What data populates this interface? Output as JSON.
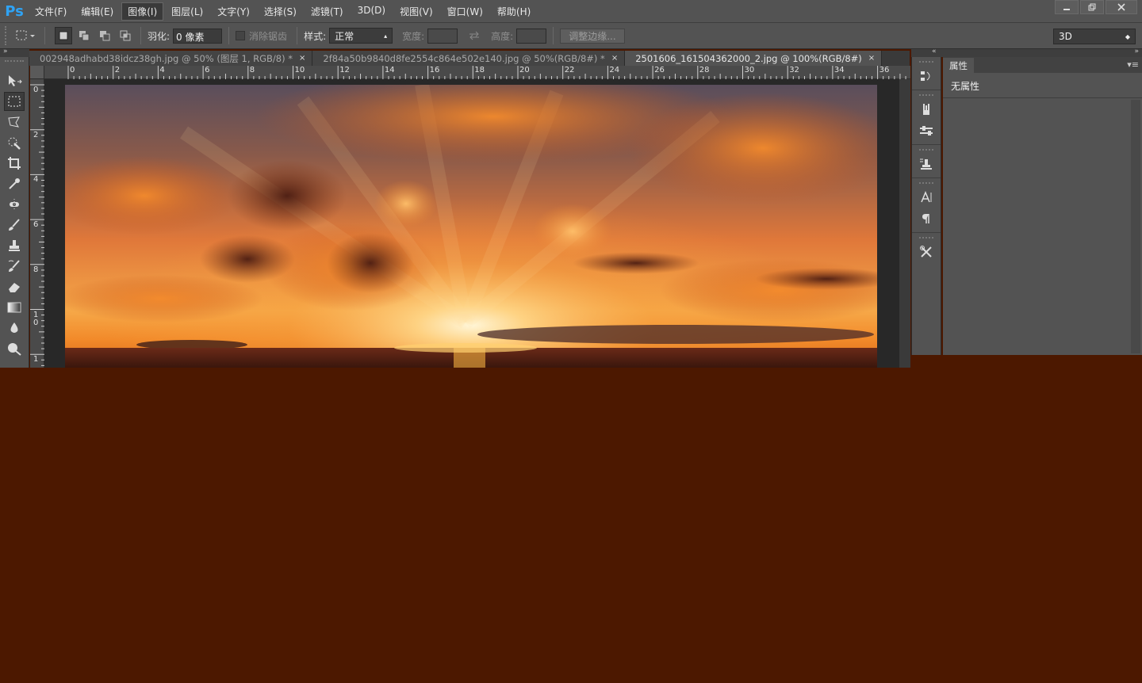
{
  "app": {
    "logo": "Ps"
  },
  "menu": [
    {
      "label": "文件(F)"
    },
    {
      "label": "编辑(E)"
    },
    {
      "label": "图像(I)",
      "active": true
    },
    {
      "label": "图层(L)"
    },
    {
      "label": "文字(Y)"
    },
    {
      "label": "选择(S)"
    },
    {
      "label": "滤镜(T)"
    },
    {
      "label": "3D(D)"
    },
    {
      "label": "视图(V)"
    },
    {
      "label": "窗口(W)"
    },
    {
      "label": "帮助(H)"
    }
  ],
  "options": {
    "feather_label": "羽化:",
    "feather_value": "0 像素",
    "antialias_label": "消除锯齿",
    "style_label": "样式:",
    "style_value": "正常",
    "width_label": "宽度:",
    "height_label": "高度:",
    "refine_edge_label": "调整边缘...",
    "workspace_value": "3D"
  },
  "tabs": [
    {
      "label": "002948adhabd38idcz38gh.jpg @ 50% (图层 1, RGB/8) *",
      "active": false
    },
    {
      "label": "2f84a50b9840d8fe2554c864e502e140.jpg @ 50%(RGB/8#) *",
      "active": false
    },
    {
      "label": "2501606_161504362000_2.jpg @ 100%(RGB/8#)",
      "active": true
    }
  ],
  "ruler_h": [
    "0",
    "2",
    "4",
    "6",
    "8",
    "10",
    "12",
    "14",
    "16",
    "18",
    "20",
    "22",
    "24",
    "26",
    "28",
    "30",
    "32",
    "34",
    "36"
  ],
  "ruler_v": [
    "0",
    "2",
    "4",
    "6",
    "8",
    "10",
    "1"
  ],
  "properties": {
    "tab_label": "属性",
    "body_text": "无属性"
  },
  "colors": {
    "panel": "#535353",
    "dark": "#282828",
    "background_fill": "#4c1800",
    "accent": "#2fa3f5"
  }
}
